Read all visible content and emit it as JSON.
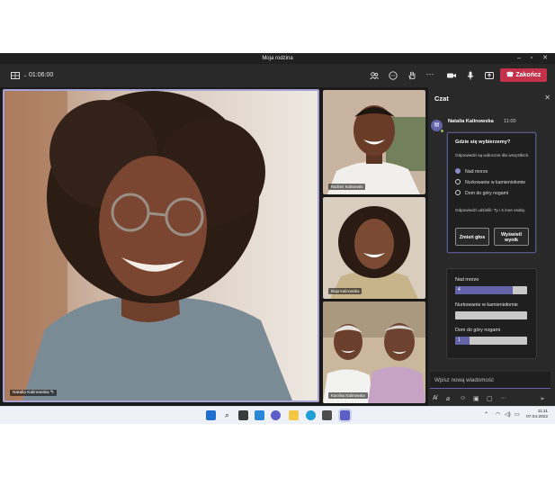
{
  "window": {
    "title": "Moja rodzina"
  },
  "toolbar": {
    "timer": "01:06:00",
    "end_label": "Zakończ"
  },
  "participants": [
    {
      "name": "Natalia Kalinowska"
    },
    {
      "name": "Radimir Kalinowski"
    },
    {
      "name": "Maja Kalinowska"
    },
    {
      "name": "Karolina Kalinowska"
    }
  ],
  "chat": {
    "title": "Czat",
    "message": {
      "sender": "Natalia Kalinowska",
      "time": "11:00",
      "poll": {
        "question": "Gdzie się wybierzemy?",
        "visibility_note": "Odpowiedzi są widoczne dla wszystkich.",
        "options": [
          {
            "label": "Nad morze",
            "selected": true
          },
          {
            "label": "Nurkowanie w kamieniołomie",
            "selected": false
          },
          {
            "label": "Dom do góry nogami",
            "selected": false
          }
        ],
        "responses_note": "Odpowiedzi udzielili: Ty i 4 inne osoby.",
        "change_vote_label": "Zmień głos",
        "show_results_label": "Wyświetl wynik"
      }
    },
    "results": [
      {
        "label": "Nad morze",
        "count": "4",
        "fraction": 0.8
      },
      {
        "label": "Nurkowanie w kamieniołomie",
        "count": "",
        "fraction": 0.0
      },
      {
        "label": "Dom do góry nogami",
        "count": "1",
        "fraction": 0.2
      }
    ],
    "compose_placeholder": "Wpisz nową wiadomość"
  },
  "taskbar": {
    "time": "11:11",
    "date": "07.04.2022"
  },
  "colors": {
    "accent": "#6264a7",
    "end_call": "#c4314b",
    "selection_border": "#a6a2d6"
  },
  "icons": [
    "grid-view-icon",
    "people-icon",
    "chat-icon",
    "raise-hand-icon",
    "more-icon",
    "camera-icon",
    "microphone-icon",
    "share-icon",
    "phone-hangup-icon"
  ]
}
